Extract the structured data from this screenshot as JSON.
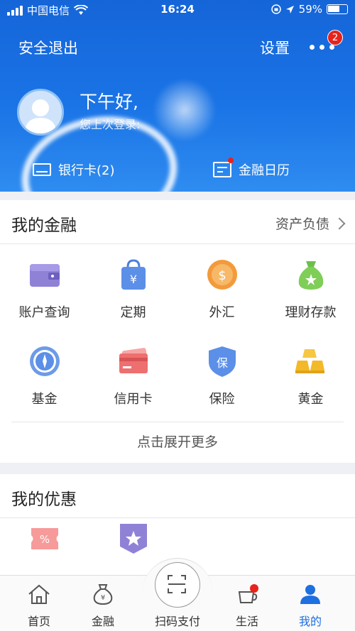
{
  "status": {
    "carrier": "中国电信",
    "time": "16:24",
    "battery": "59%"
  },
  "header": {
    "logout": "安全退出",
    "settings": "设置",
    "badge": "2",
    "greeting": "下午好,",
    "last_login": "您上次登录:",
    "bank_card": "银行卡(2)",
    "calendar": "金融日历"
  },
  "finance": {
    "title": "我的金融",
    "more": "资产负债",
    "items": [
      {
        "label": "账户查询",
        "icon": "wallet-icon"
      },
      {
        "label": "定期",
        "icon": "yen-bag-icon"
      },
      {
        "label": "外汇",
        "icon": "dollar-coin-icon"
      },
      {
        "label": "理财存款",
        "icon": "money-bag-icon"
      },
      {
        "label": "基金",
        "icon": "compass-icon"
      },
      {
        "label": "信用卡",
        "icon": "credit-card-icon"
      },
      {
        "label": "保险",
        "icon": "shield-icon"
      },
      {
        "label": "黄金",
        "icon": "gold-bar-icon"
      }
    ],
    "expand": "点击展开更多"
  },
  "offers": {
    "title": "我的优惠"
  },
  "tabs": [
    {
      "label": "首页"
    },
    {
      "label": "金融"
    },
    {
      "label": "扫码支付"
    },
    {
      "label": "生活"
    },
    {
      "label": "我的"
    }
  ],
  "colors": {
    "header_blue": "#1a74e6",
    "active_tab": "#1e6fe0",
    "badge_red": "#e8231b"
  }
}
